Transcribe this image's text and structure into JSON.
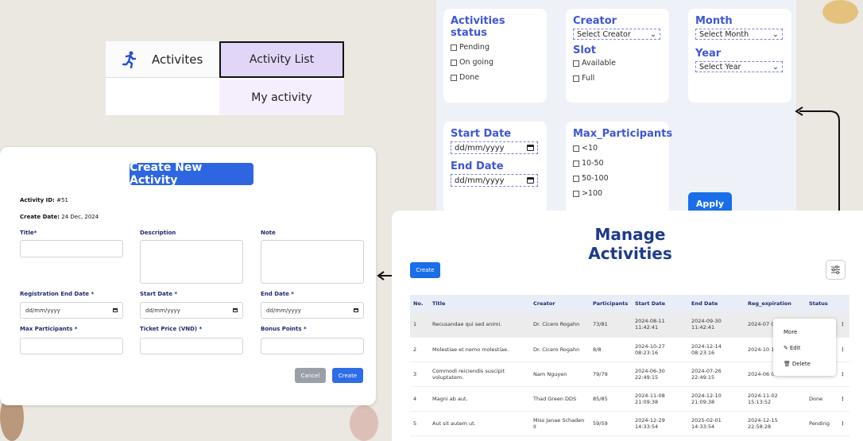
{
  "tabs": {
    "activites": "Activites",
    "activity_list": "Activity List",
    "my_activity": "My activity"
  },
  "filter": {
    "status": {
      "title": "Activities status",
      "options": [
        "Pending",
        "On going",
        "Done"
      ]
    },
    "creator": {
      "title": "Creator",
      "placeholder": "Select Creator"
    },
    "slot": {
      "title": "Slot",
      "options": [
        "Available",
        "Full"
      ]
    },
    "month": {
      "title": "Month",
      "placeholder": "Select Month"
    },
    "year": {
      "title": "Year",
      "placeholder": "Select Year"
    },
    "start_date": {
      "title": "Start Date",
      "value": "dd/mm/yyyy"
    },
    "end_date": {
      "title": "End Date",
      "value": "dd/mm/yyyy"
    },
    "max_participants": {
      "title": "Max_Participants",
      "options": [
        "<10",
        "10-50",
        "50-100",
        ">100"
      ]
    },
    "apply": "Apply"
  },
  "form": {
    "title": "Create New Activity",
    "activity_id_label": "Activity ID:",
    "activity_id": "#51",
    "create_date_label": "Create Date:",
    "create_date": "24 Dec, 2024",
    "labels": {
      "title": "Title*",
      "description": "Description",
      "note": "Note",
      "reg_end": "Registration End Date *",
      "start": "Start Date *",
      "end": "End Date *",
      "max": "Max Participants *",
      "price": "Ticket Price (VND) *",
      "bonus": "Bonus Points *"
    },
    "date_placeholder": "dd/mm/yyyy",
    "cancel": "Cancel",
    "create": "Create"
  },
  "manage": {
    "title": "Manage Activities",
    "create": "Create",
    "columns": [
      "No.",
      "Title",
      "Creator",
      "Participants",
      "Start Date",
      "End Date",
      "Reg_expiration",
      "Status"
    ],
    "rows": [
      [
        "1",
        "Recusandae qui sed animi.",
        "Dr. Cicero Rogahn",
        "73/81",
        "2024-08-11 11:42:41",
        "2024-09-30 11:42:41",
        "2024-07 02:14:04",
        ""
      ],
      [
        "2",
        "Molestiae et nemo molestiae.",
        "Dr. Cicero Rogahn",
        "8/8",
        "2024-10-27 08:23:16",
        "2024-12-14 08:23:16",
        "2024-10 11:42:06",
        ""
      ],
      [
        "3",
        "Commodi reiciendis suscipit voluptatem.",
        "Nam Nguyen",
        "79/79",
        "2024-06-30 22:49:15",
        "2024-07-26 22:49:15",
        "2024-06 08:31:27",
        ""
      ],
      [
        "4",
        "Magni ab aut.",
        "Thad Green DDS",
        "85/85",
        "2024-11-08 21:09:38",
        "2024-12-10 21:09:38",
        "2024-11-02 15:13:52",
        "Done"
      ],
      [
        "5",
        "Aut sit autem ut.",
        "Miss Janae Schaden II",
        "59/59",
        "2024-12-29 14:33:54",
        "2025-02-01 14:33:54",
        "2024-12-15 22:58:28",
        "Pending"
      ]
    ],
    "menu": [
      "More",
      "Edit",
      "Delete"
    ]
  },
  "icons": [
    "running-icon",
    "chevron-down-icon",
    "calendar-icon",
    "filter-sliders-icon",
    "kebab-menu-icon",
    "pencil-icon",
    "trash-icon",
    "arrow-icon"
  ]
}
